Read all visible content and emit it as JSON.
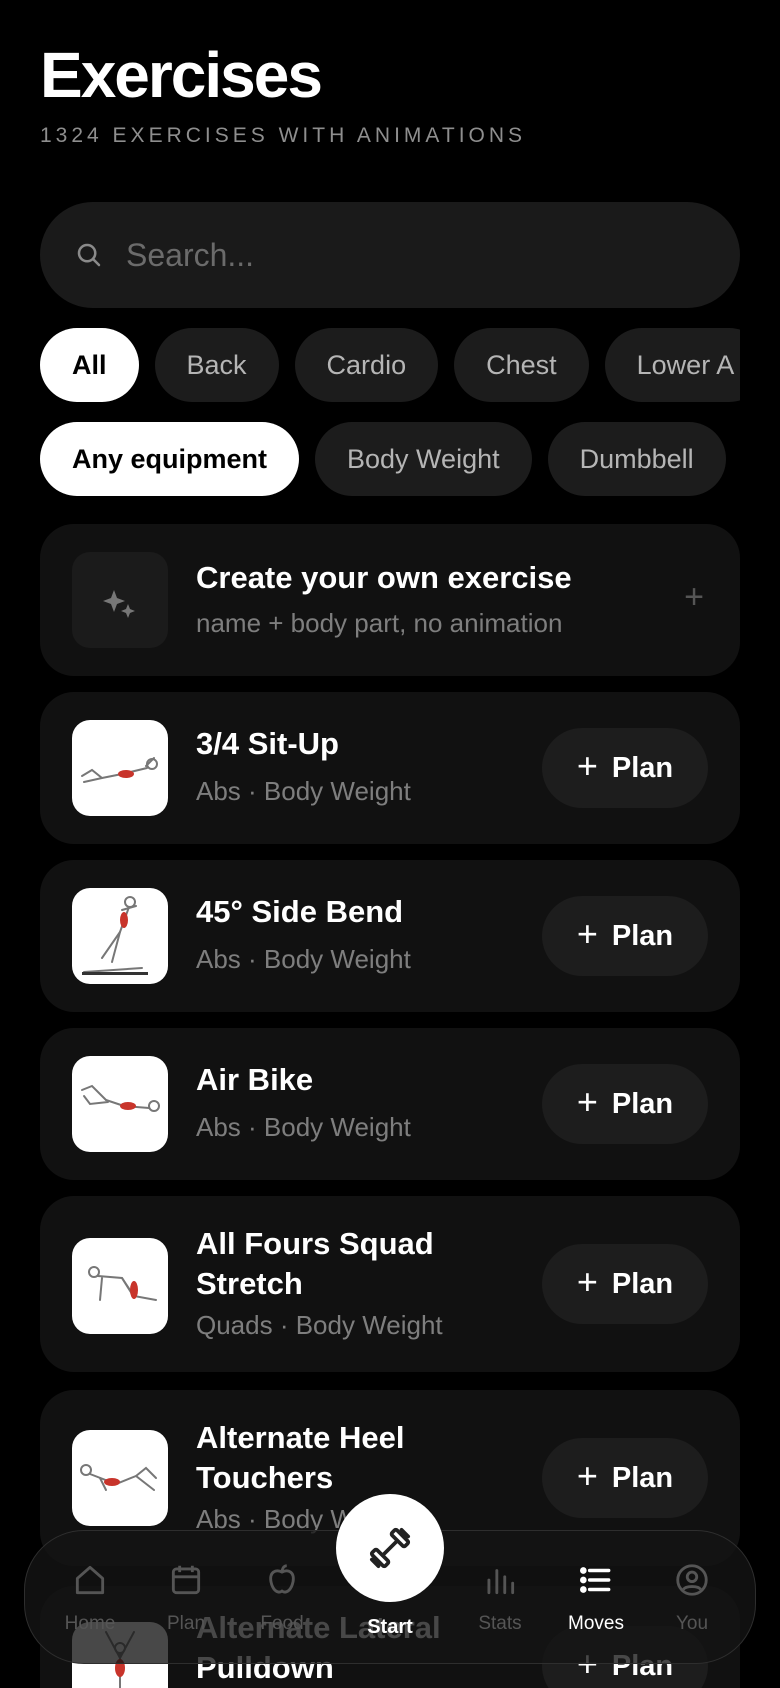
{
  "header": {
    "title": "Exercises",
    "subtitle": "1324 EXERCISES WITH ANIMATIONS"
  },
  "search": {
    "placeholder": "Search..."
  },
  "body_part_filters": [
    "All",
    "Back",
    "Cardio",
    "Chest",
    "Lower A"
  ],
  "equipment_filters": [
    "Any equipment",
    "Body Weight",
    "Dumbbell"
  ],
  "create_card": {
    "title": "Create your own exercise",
    "subtitle": "name + body part, no animation"
  },
  "plan_label": "Plan",
  "exercises": [
    {
      "name": "3/4 Sit-Up",
      "meta": "Abs · Body Weight"
    },
    {
      "name": "45° Side Bend",
      "meta": "Abs · Body Weight"
    },
    {
      "name": "Air Bike",
      "meta": "Abs · Body Weight"
    },
    {
      "name": "All Fours Squad Stretch",
      "meta": "Quads · Body Weight"
    },
    {
      "name": "Alternate Heel Touchers",
      "meta": "Abs · Body Weight"
    },
    {
      "name": "Alternate Lateral Pulldown",
      "meta": ""
    }
  ],
  "tabbar": {
    "tabs": [
      "Home",
      "Plan",
      "Food",
      "Stats",
      "Moves",
      "You"
    ],
    "start_label": "Start",
    "active_tab": "Moves"
  },
  "colors": {
    "background": "#000000",
    "card": "#111111",
    "chip": "#1c1c1c",
    "accent_muscle": "#c8342b"
  }
}
